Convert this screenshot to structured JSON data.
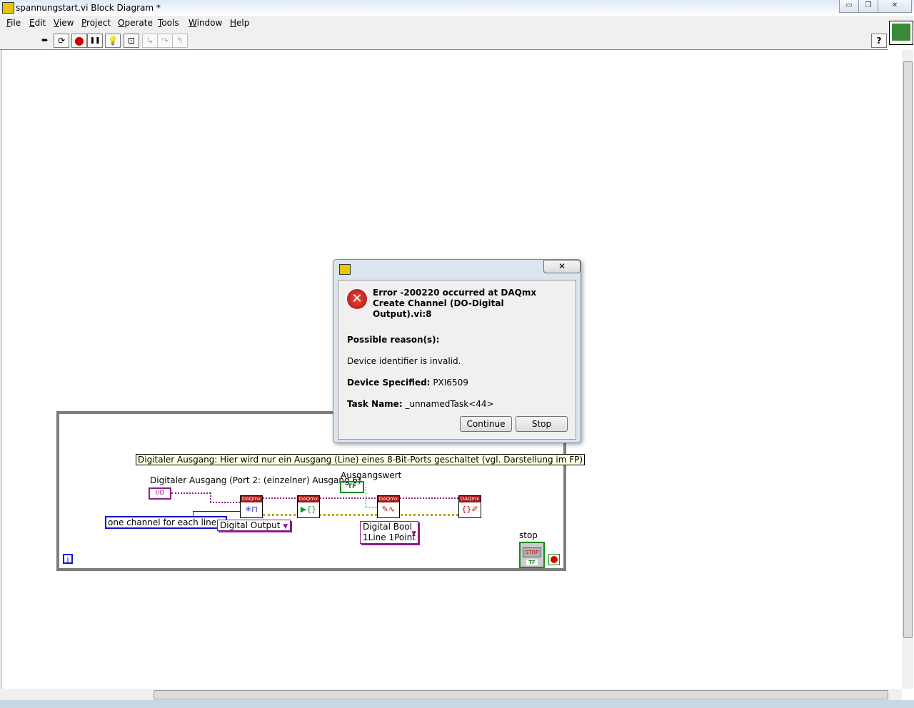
{
  "window": {
    "title": "spannungstart.vi Block Diagram *",
    "minimize": "▭",
    "restore": "❐",
    "close": "✕"
  },
  "menu": [
    "File",
    "Edit",
    "View",
    "Project",
    "Operate",
    "Tools",
    "Window",
    "Help"
  ],
  "toolbar": {
    "run": "➨",
    "run_continuously": "⟳",
    "abort": "●",
    "pause": "❚❚",
    "highlight": "💡",
    "retain_wire": "⊡",
    "step_into": "↳",
    "step_over": "↷",
    "step_out": "↰",
    "help": "?"
  },
  "diagram": {
    "comment": "Digitaler Ausgang: Hier wird nur ein Ausgang (Line) eines 8-Bit-Ports geschaltet (vgl. Darstellung im FP)",
    "channel_label": "Digitaler Ausgang (Port 2: (einzelner) Ausgang 6)",
    "channel_const": "I/O",
    "value_label": "Ausgangswert",
    "value_terminal": "TF",
    "line_grouping": "one channel for each line",
    "create_channel_type": "Digital Output",
    "write_type_line1": "Digital Bool",
    "write_type_line2": "1Line 1Point",
    "daqmx_header": "DAQmx",
    "stop_label": "stop",
    "stop_button": "STOP",
    "stop_terminal": "TF",
    "iteration": "i"
  },
  "dialog": {
    "error_title": "Error -200220 occurred at DAQmx Create Channel (DO-Digital Output).vi:8",
    "possible_reasons_label": "Possible reason(s):",
    "reason": "Device identifier is invalid.",
    "device_label": "Device Specified:",
    "device_value": "PXI6509",
    "task_label": "Task Name:",
    "task_value": "_unnamedTask<44>",
    "continue": "Continue",
    "stop": "Stop",
    "close": "✕"
  }
}
